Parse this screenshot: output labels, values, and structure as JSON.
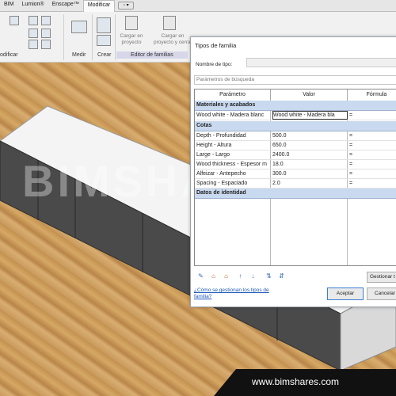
{
  "ribbon": {
    "tabs": [
      "BIM",
      "Lumion®",
      "Enscape™",
      "Modificar"
    ],
    "extra_tab": "▫ ▾",
    "groups": {
      "modificar": "odificar",
      "medir": "Medir",
      "crear": "Crear",
      "editor": "Editor de familias"
    },
    "load_project": "Cargar en\nproyecto",
    "load_close": "Cargar en\nproyecto y cerrar"
  },
  "watermark": "BIMSHARES",
  "dialog": {
    "title": "Tipos de familia",
    "type_label": "Nombre de tipo:",
    "search_placeholder": "Parámetros de búsqueda",
    "columns": [
      "Parámetro",
      "Valor",
      "Fórmula"
    ],
    "groups": [
      {
        "name": "Materiales y acabados",
        "rows": [
          {
            "param": "Wood white - Madera blanc",
            "value": "Wood white - Madera bla",
            "formula": "="
          }
        ]
      },
      {
        "name": "Cotas",
        "rows": [
          {
            "param": "Depth - Profundidad",
            "value": "500.0",
            "formula": "="
          },
          {
            "param": "Height - Altura",
            "value": "650.0",
            "formula": "="
          },
          {
            "param": "Large - Largo",
            "value": "2400.0",
            "formula": "="
          },
          {
            "param": "Wood thickness - Espesor m",
            "value": "18.0",
            "formula": "="
          },
          {
            "param": "Alfeizar - Antepecho",
            "value": "300.0",
            "formula": "="
          },
          {
            "param": "Spacing - Espaciado",
            "value": "2.0",
            "formula": "="
          }
        ]
      },
      {
        "name": "Datos de identidad",
        "rows": []
      }
    ],
    "toolbar_icons": [
      "pencil-icon",
      "new-type-icon",
      "rename-type-icon",
      "delete-type-icon",
      "move-up-icon",
      "move-down-icon",
      "sort-ascending-icon",
      "sort-descending-icon"
    ],
    "manage_button": "Gestionar t",
    "help_link": "¿Cómo se gestionan los tipos de familia?",
    "ok_button": "Aceptar",
    "cancel_button": "Cancelar"
  },
  "banner": "www.bimshares.com"
}
